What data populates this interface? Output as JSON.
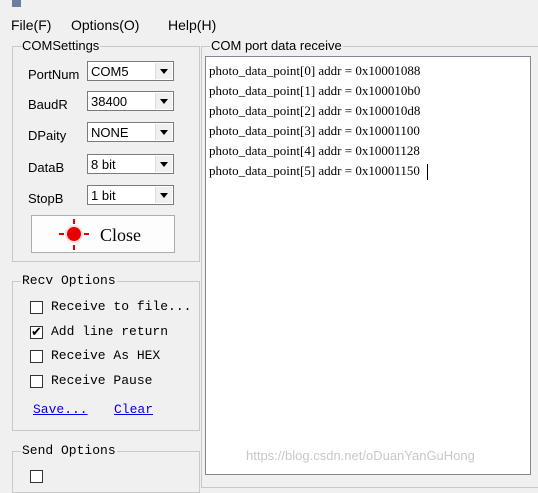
{
  "menu": {
    "file": "File(F)",
    "options": "Options(O)",
    "help": "Help(H)"
  },
  "com_settings": {
    "title": "COMSettings",
    "port_label": "PortNum",
    "port_value": "COM5",
    "baud_label": "BaudR",
    "baud_value": "38400",
    "parity_label": "DPaity",
    "parity_value": "NONE",
    "data_label": "DataB",
    "data_value": "8 bit",
    "stop_label": "StopB",
    "stop_value": "1 bit",
    "close_label": "Close"
  },
  "recv_options": {
    "title": "Recv Options",
    "items": [
      {
        "label": "Receive to file...",
        "checked": false
      },
      {
        "label": "Add line return",
        "checked": true
      },
      {
        "label": "Receive As HEX",
        "checked": false
      },
      {
        "label": "Receive Pause",
        "checked": false
      }
    ],
    "save_link": "Save...",
    "clear_link": "Clear"
  },
  "send_options": {
    "title": "Send Options"
  },
  "receive_panel": {
    "title": "COM port data receive",
    "lines": [
      "photo_data_point[0] addr = 0x10001088",
      "photo_data_point[1] addr = 0x100010b0",
      "photo_data_point[2] addr = 0x100010d8",
      "photo_data_point[3] addr = 0x10001100",
      "photo_data_point[4] addr = 0x10001128",
      "photo_data_point[5] addr = 0x10001150"
    ]
  },
  "watermark": "https://blog.csdn.net/oDuanYanGuHong",
  "colors": {
    "background": "#f0f0f0",
    "led_red": "#e60000",
    "link_blue": "#0000ee"
  }
}
